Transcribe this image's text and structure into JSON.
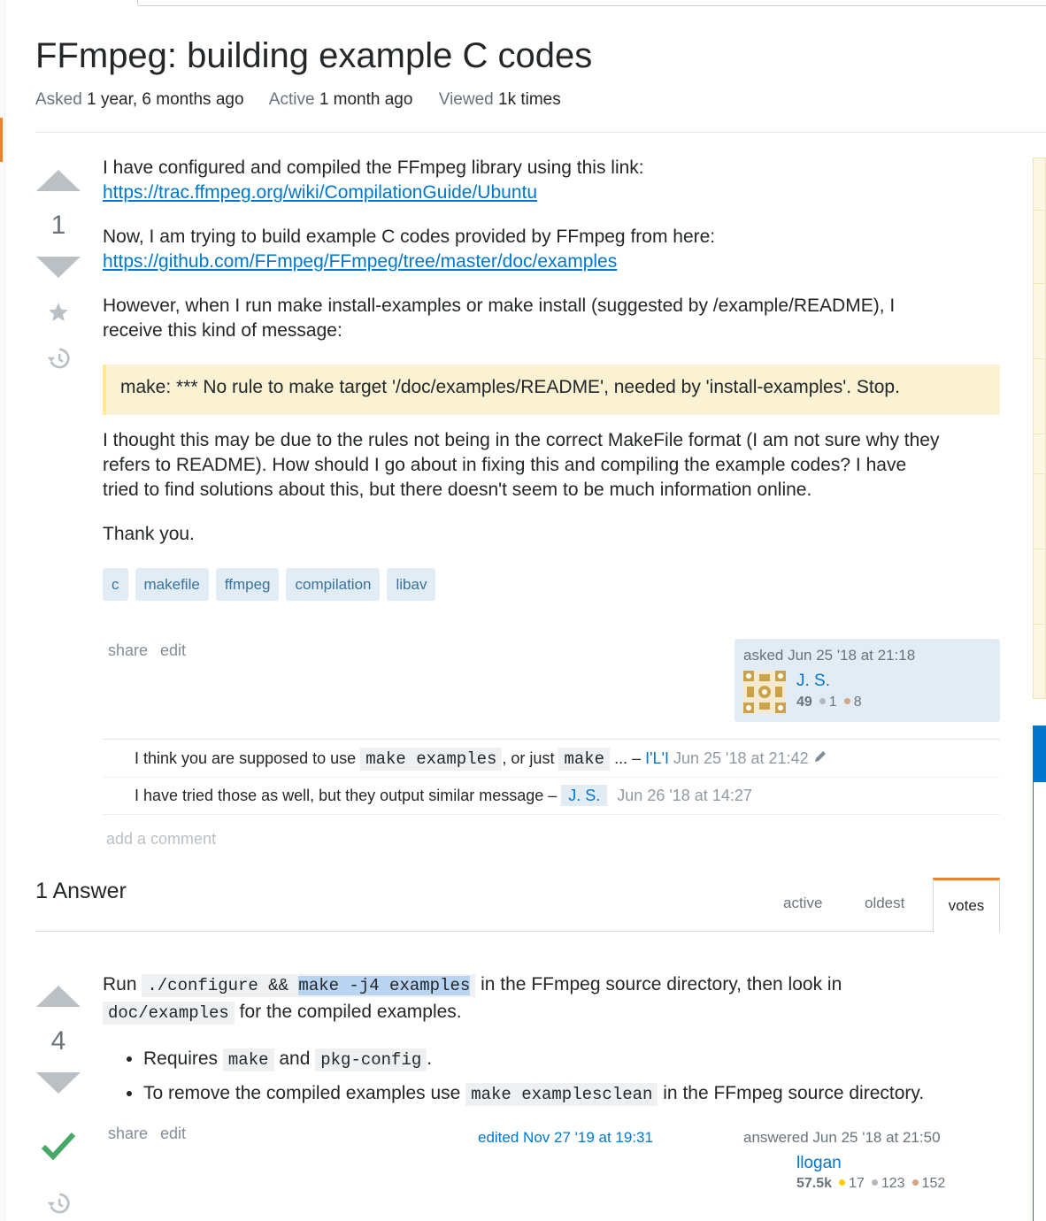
{
  "question": {
    "title": "FFmpeg: building example C codes",
    "meta": {
      "asked_label": "Asked",
      "asked_value": "1 year, 6 months ago",
      "active_label": "Active",
      "active_value": "1 month ago",
      "viewed_label": "Viewed",
      "viewed_value": "1k times"
    },
    "votes": "1",
    "body": {
      "p1_text": "I have configured and compiled the FFmpeg library using this link:",
      "p1_link": "https://trac.ffmpeg.org/wiki/CompilationGuide/Ubuntu",
      "p2_text": "Now, I am trying to build example C codes provided by FFmpeg from here:",
      "p2_link": "https://github.com/FFmpeg/FFmpeg/tree/master/doc/examples",
      "p3_line1": "However, when I run make install-examples or make install (suggested by /example/README), I",
      "p3_line2": "receive this kind of message:",
      "quote": "make: *** No rule to make target '/doc/examples/README', needed by 'install-examples'. Stop.",
      "p4_line1": "I thought this may be due to the rules not being in the correct MakeFile format (I am not sure why they",
      "p4_line2": "refers to README). How should I go about in fixing this and compiling the example codes? I have",
      "p4_line3": "tried to find solutions about this, but there doesn't seem to be much information online.",
      "p5": "Thank you."
    },
    "tags": [
      "c",
      "makefile",
      "ffmpeg",
      "compilation",
      "libav"
    ],
    "menu": {
      "share": "share",
      "edit": "edit"
    },
    "owner": {
      "asked_text": "asked Jun 25 '18 at 21:18",
      "name": "J. S.",
      "rep": "49",
      "silver": "1",
      "bronze": "8"
    },
    "comments": [
      {
        "pre": "I think you are supposed to use",
        "code1": "make examples",
        "mid": ", or just",
        "code2": "make",
        "post": " ... –",
        "user": "I'L'I",
        "date": "Jun 25 '18 at 21:42"
      },
      {
        "text": "I have tried those as well, but they output similar message –",
        "user": "J. S.",
        "date": "Jun 26 '18 at 14:27"
      }
    ],
    "add_comment": "add a comment"
  },
  "answers_header": {
    "count_label": "1 Answer",
    "tabs": [
      "active",
      "oldest",
      "votes"
    ]
  },
  "answer": {
    "votes": "4",
    "run": "Run",
    "code_configure": "./configure &&",
    "code_make": "make -j4 examples",
    "line1_rest": "in the FFmpeg source directory, then look in",
    "code_doc": "doc/examples",
    "line2_rest": "for the compiled examples.",
    "bullet1_a": "Requires",
    "bullet1_code1": "make",
    "bullet1_b": "and",
    "bullet1_code2": "pkg-config",
    "bullet1_c": ".",
    "bullet2_a": "To remove the compiled examples use",
    "bullet2_code": "make examplesclean",
    "bullet2_b": "in the FFmpeg source directory.",
    "menu": {
      "share": "share",
      "edit": "edit"
    },
    "edited": "edited Nov 27 '19 at 19:31",
    "answered": "answered Jun 25 '18 at 21:50",
    "user": "llogan",
    "rep": "57.5k",
    "gold": "17",
    "silver": "123",
    "bronze": "152"
  },
  "colors": {
    "link": "#0077cc",
    "accent": "#f48024",
    "accepted": "#48a868"
  }
}
